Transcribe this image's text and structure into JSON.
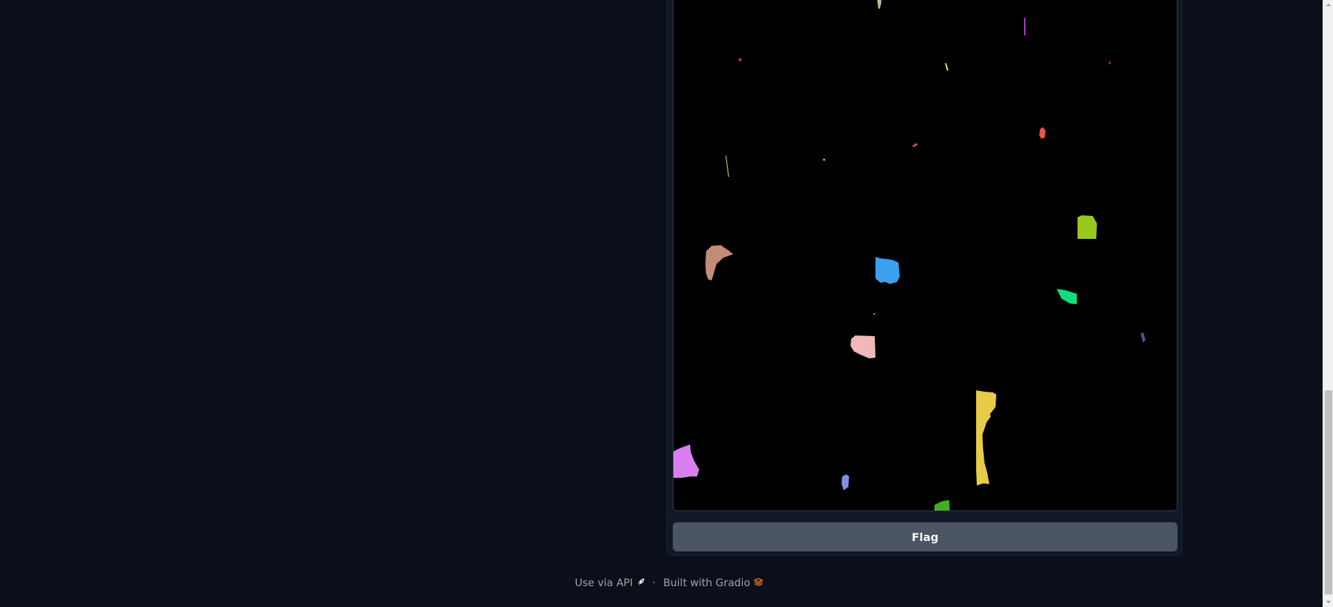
{
  "output": {
    "image_alt": "Segmentation mask output",
    "colors": {
      "background": "#000000",
      "segments": [
        "#c8b48c",
        "#b23ac8",
        "#d2423c",
        "#e8e070",
        "#c8508c",
        "#e8544a",
        "#e8e050",
        "#98c81c",
        "#c48c78",
        "#3aa0f0",
        "#14dc7c",
        "#f0b8b8",
        "#6a4888",
        "#e8cc48",
        "#d880f0",
        "#8090e0",
        "#40b020"
      ]
    }
  },
  "flag_button": {
    "label": "Flag"
  },
  "footer": {
    "api_label": "Use via API",
    "api_icon": "rocket-icon",
    "separator": "·",
    "built_label": "Built with Gradio",
    "gradio_icon": "gradio-logo-icon"
  },
  "theme": {
    "page_bg": "#0b0f19",
    "panel_bg": "#111827",
    "button_bg": "#4b5563",
    "text_muted": "#9ca3af"
  }
}
